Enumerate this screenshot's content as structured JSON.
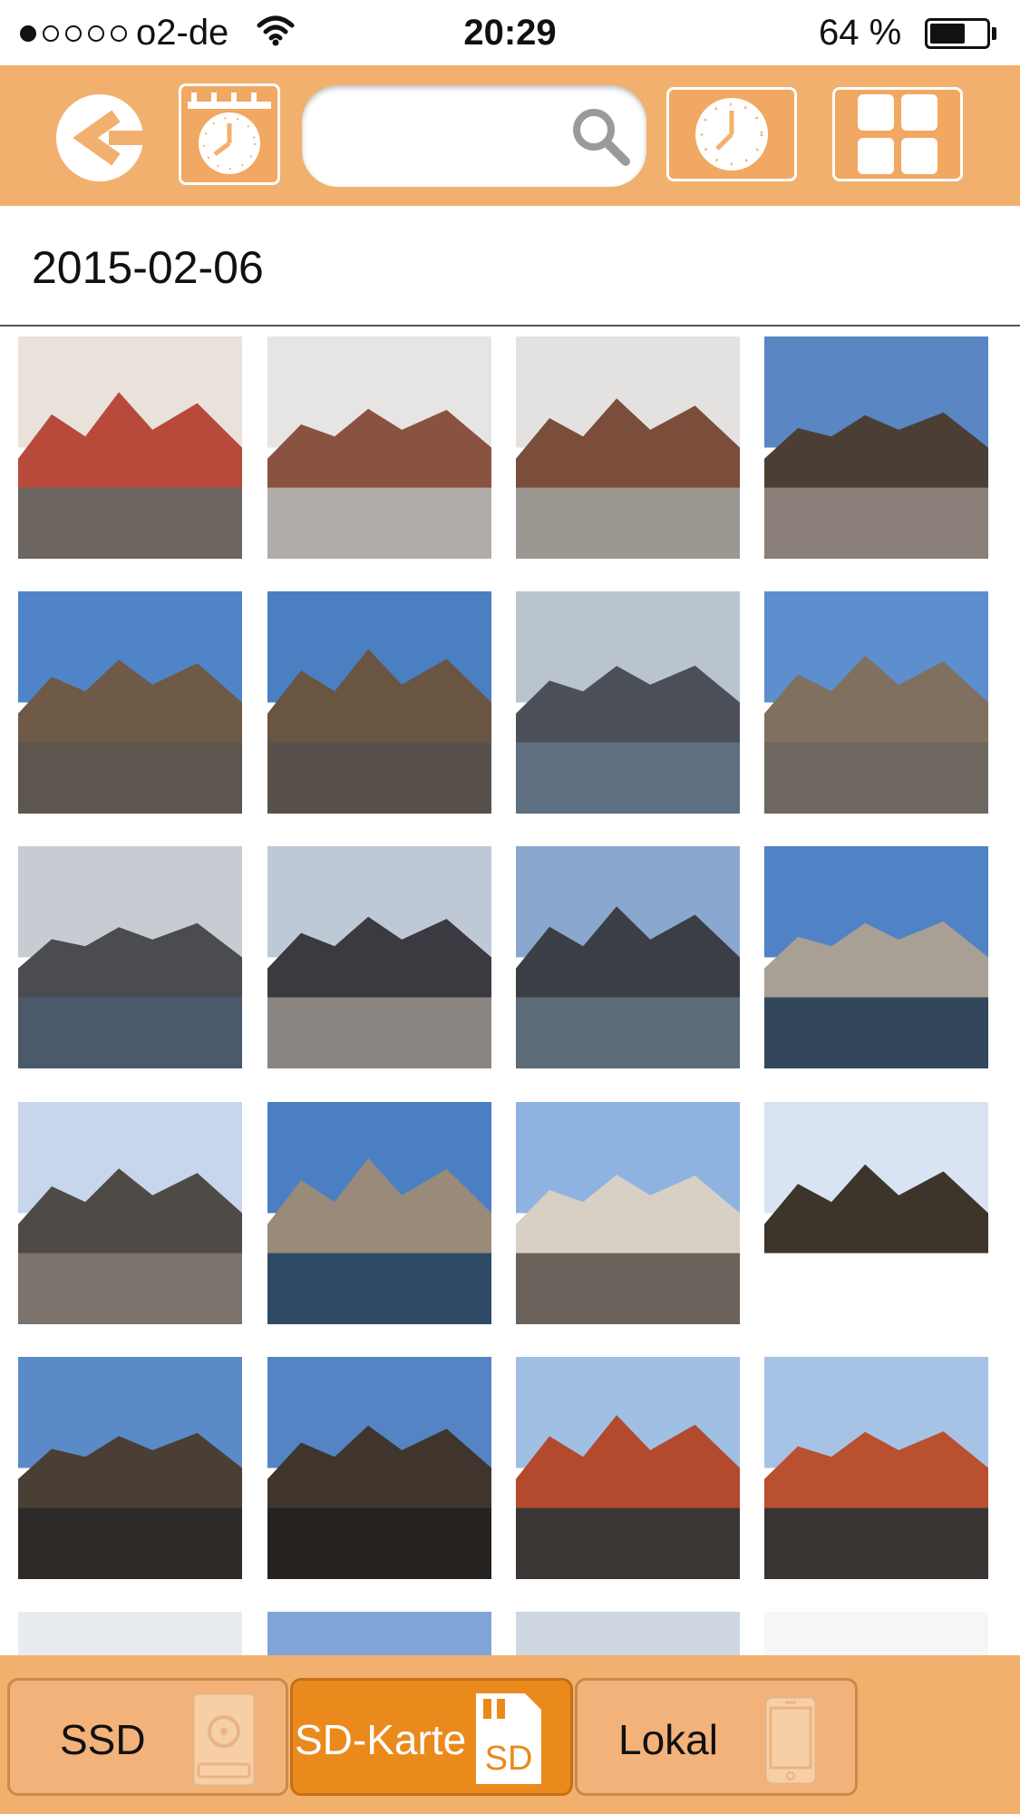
{
  "status_bar": {
    "carrier": "o2-de",
    "time": "20:29",
    "battery_percent": "64 %",
    "battery_level": 0.64,
    "signal_bars": 1
  },
  "toolbar": {
    "search_placeholder": "",
    "search_value": ""
  },
  "date_header": "2015-02-06",
  "photos": [
    {
      "name": "graffiti-wall",
      "sky": "#e9e2da",
      "mid": "#b84a3c",
      "ground": "#6d6660"
    },
    {
      "name": "cage-sculpture-upside-down",
      "sky": "#e7e5e3",
      "mid": "#8a5240",
      "ground": "#b1aca8"
    },
    {
      "name": "cage-sculpture-tilted",
      "sky": "#e4e2e0",
      "mid": "#7a4e3a",
      "ground": "#9d9792"
    },
    {
      "name": "bridge-statues-1",
      "sky": "#5a86c4",
      "mid": "#4b3f35",
      "ground": "#8a8079"
    },
    {
      "name": "bridge-tower-1",
      "sky": "#4f85c8",
      "mid": "#6e5a47",
      "ground": "#5d564f"
    },
    {
      "name": "bridge-tower-2",
      "sky": "#4a7fc2",
      "mid": "#6a5442",
      "ground": "#58514b"
    },
    {
      "name": "river-boat",
      "sky": "#b9c4cf",
      "mid": "#4b5058",
      "ground": "#5f6f82"
    },
    {
      "name": "bridge-dome",
      "sky": "#5d8fcf",
      "mid": "#807060",
      "ground": "#6e6861"
    },
    {
      "name": "river-bridge",
      "sky": "#c8ccd2",
      "mid": "#4a4c50",
      "ground": "#4b5a6b"
    },
    {
      "name": "crowd-bridge",
      "sky": "#bfc9d6",
      "mid": "#3a3a40",
      "ground": "#8a8580"
    },
    {
      "name": "river-sun",
      "sky": "#8aa7cf",
      "mid": "#3b3f45",
      "ground": "#5e6b78"
    },
    {
      "name": "castle-view",
      "sky": "#4f83c6",
      "mid": "#a89f95",
      "ground": "#34465c"
    },
    {
      "name": "bridge-walkers",
      "sky": "#c7d6ea",
      "mid": "#4e4a46",
      "ground": "#7b736c"
    },
    {
      "name": "castle-river",
      "sky": "#4a7fc4",
      "mid": "#9a8a7a",
      "ground": "#2f4a66"
    },
    {
      "name": "church-facade",
      "sky": "#8fb3e0",
      "mid": "#d8d0c4",
      "ground": "#6b625b"
    },
    {
      "name": "tower-from-below",
      "sky": "#d9e4f2",
      "mid": "#3d342c",
      "ground": "#ffffff"
    },
    {
      "name": "tower-street-1",
      "sky": "#5b8ac8",
      "mid": "#4a3f35",
      "ground": "#2e2a27"
    },
    {
      "name": "tower-street-2",
      "sky": "#5584c4",
      "mid": "#3f352d",
      "ground": "#252220"
    },
    {
      "name": "red-building-church-1",
      "sky": "#9fbfe3",
      "mid": "#b34a2e",
      "ground": "#3b3633"
    },
    {
      "name": "red-building-church-2",
      "sky": "#a6c3e6",
      "mid": "#b9502f",
      "ground": "#3a3532"
    },
    {
      "name": "partial-1",
      "sky": "#e8ecf1",
      "mid": "#a9563c",
      "ground": "#d0c8c0"
    },
    {
      "name": "partial-2",
      "sky": "#7fa5d6",
      "mid": "#cfc6bb",
      "ground": "#b8b0a7"
    },
    {
      "name": "partial-3",
      "sky": "#cfd7e2",
      "mid": "#6d6258",
      "ground": "#b6ada3"
    },
    {
      "name": "partial-4",
      "sky": "#f4f6f8",
      "mid": "#d8b894",
      "ground": "#cfc6bd"
    }
  ],
  "bottom_tabs": [
    {
      "label": "SSD",
      "active": false,
      "icon": "ssd-drive-icon"
    },
    {
      "label": "SD-Karte",
      "active": true,
      "icon": "sd-card-icon",
      "icon_text": "SD"
    },
    {
      "label": "Lokal",
      "active": false,
      "icon": "phone-icon"
    }
  ],
  "colors": {
    "accent": "#f2b06e",
    "active_tab": "#ea8a1c",
    "divider": "#555555"
  }
}
